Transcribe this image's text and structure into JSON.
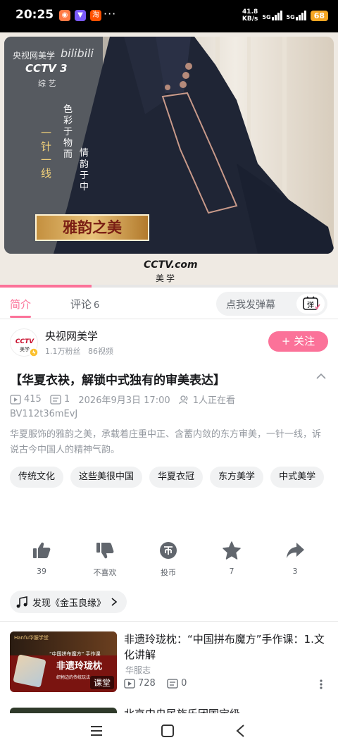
{
  "status_bar": {
    "time": "20:25",
    "apps": [
      {
        "name": "app-icon-1",
        "glyph": "◉",
        "color": "#ff7a45"
      },
      {
        "name": "app-icon-2",
        "glyph": "▼",
        "color": "#7a5af8"
      },
      {
        "name": "taobao-icon",
        "glyph": "淘",
        "color": "#ff5000"
      }
    ],
    "more": "···",
    "net_speed": "41.8",
    "net_unit": "KB/s",
    "signal_1": "5G",
    "signal_2": "5G",
    "battery": "68"
  },
  "video": {
    "watermark_channel": "央视网美学",
    "watermark_bili": "bilibili",
    "watermark_cctv": "CCTV 3",
    "watermark_sub": "综 艺",
    "text_a": "一针一线",
    "text_b": "色彩于物而",
    "text_c": "情韵于中",
    "banner": "雅韵之美",
    "logo_bottom": "CCTV.com",
    "logo_bottom_sub": "美学",
    "progress": 0.27
  },
  "tabs": {
    "intro": "简介",
    "comments": "评论",
    "comments_count": "6",
    "danmaku_placeholder": "点我发弹幕",
    "danmaku_button": "弹"
  },
  "uploader": {
    "name": "央视网美学",
    "avatar_text": "CCTV",
    "avatar_sub": "美学",
    "fans": "1.1万粉丝",
    "videos": "86视频",
    "follow_label": "+ 关注"
  },
  "video_info": {
    "title": "【华夏衣袂，解锁中式独有的审美表达】",
    "plays": "415",
    "danmaku_count": "1",
    "date": "2026年9月3日 17:00",
    "watching": "1人正在看",
    "bvid": "BV112t36mEvJ",
    "description": "华夏服饰的雅韵之美，承载着庄重中正、含蓄内敛的东方审美，一针一线，诉说古今中国人的精神气韵。"
  },
  "tags": [
    "传统文化",
    "这些美很中国",
    "华夏衣冠",
    "东方美学",
    "中式美学"
  ],
  "actions": [
    {
      "name": "like",
      "label": "39"
    },
    {
      "name": "dislike",
      "label": "不喜欢"
    },
    {
      "name": "coin",
      "label": "投币"
    },
    {
      "name": "favorite",
      "label": "7"
    },
    {
      "name": "share",
      "label": "3"
    }
  ],
  "music": {
    "label": "发现《金玉良缘》"
  },
  "related": [
    {
      "title": "非遗玲珑枕：“中国拼布魔方”手作课：1.文化讲解",
      "author": "华服志",
      "plays": "728",
      "danmaku": "0",
      "badge": "课堂",
      "thumb_brand": "Hanfu华服学堂",
      "thumb_sub": "“中国拼布魔方” 手作课",
      "thumb_main": "非遗玲珑枕",
      "thumb_small": "织物边的传统玩法"
    },
    {
      "title": "北京中央民族乐团国宝级"
    }
  ]
}
